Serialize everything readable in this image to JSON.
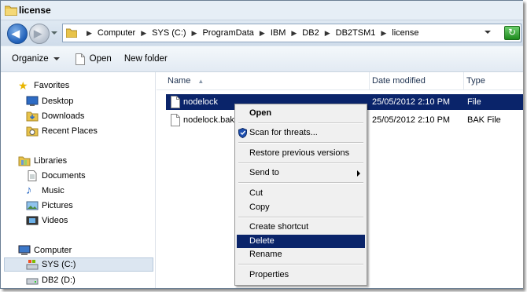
{
  "window": {
    "title": "license"
  },
  "address": {
    "crumbs": [
      "Computer",
      "SYS (C:)",
      "ProgramData",
      "IBM",
      "DB2",
      "DB2TSM1",
      "license"
    ]
  },
  "toolbar": {
    "organize_label": "Organize",
    "open_label": "Open",
    "new_folder_label": "New folder"
  },
  "nav": {
    "favorites_label": "Favorites",
    "desktop_label": "Desktop",
    "downloads_label": "Downloads",
    "recent_label": "Recent Places",
    "libraries_label": "Libraries",
    "documents_label": "Documents",
    "music_label": "Music",
    "pictures_label": "Pictures",
    "videos_label": "Videos",
    "computer_label": "Computer",
    "sys_label": "SYS (C:)",
    "db2_label": "DB2 (D:)"
  },
  "columns": {
    "name": "Name",
    "date": "Date modified",
    "type": "Type"
  },
  "files": [
    {
      "name": "nodelock",
      "date": "25/05/2012 2:10 PM",
      "type": "File"
    },
    {
      "name": "nodelock.bak",
      "date": "25/05/2012 2:10 PM",
      "type": "BAK File"
    }
  ],
  "context_menu": {
    "open": "Open",
    "scan": "Scan for threats...",
    "restore": "Restore previous versions",
    "send_to": "Send to",
    "cut": "Cut",
    "copy": "Copy",
    "create_shortcut": "Create shortcut",
    "delete": "Delete",
    "rename": "Rename",
    "properties": "Properties"
  },
  "colors": {
    "selection": "#0a246a",
    "chrome": "#d9e4ef",
    "folder": "#e8c34a"
  }
}
